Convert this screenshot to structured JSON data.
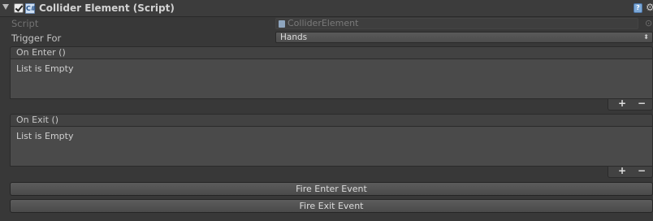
{
  "header": {
    "title": "Collider Element (Script)",
    "enabled": true,
    "icons": [
      "foldout-arrow",
      "script-icon",
      "help-icon",
      "gear-icon"
    ]
  },
  "fields": {
    "script": {
      "label": "Script",
      "value": "ColliderElement"
    },
    "trigger_for": {
      "label": "Trigger For",
      "value": "Hands"
    }
  },
  "events": [
    {
      "title": "On Enter ()",
      "empty_text": "List is Empty",
      "add": "+",
      "remove": "−"
    },
    {
      "title": "On Exit ()",
      "empty_text": "List is Empty",
      "add": "+",
      "remove": "−"
    }
  ],
  "buttons": {
    "fire_enter": "Fire Enter Event",
    "fire_exit": "Fire Exit Event"
  }
}
